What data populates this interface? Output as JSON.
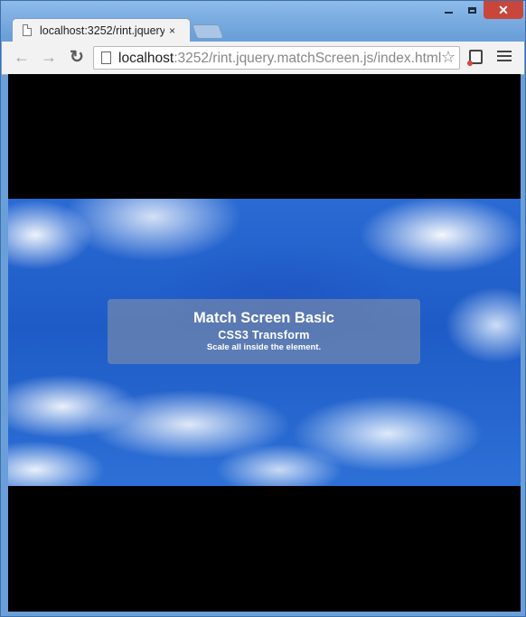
{
  "browser": {
    "tab": {
      "title": "localhost:3252/rint.jquery",
      "close": "×"
    },
    "address_bar": {
      "host": "localhost",
      "rest": ":3252/rint.jquery.matchScreen.js/index.html"
    },
    "icons": {
      "back": "←",
      "forward": "→",
      "reload": "↻",
      "bookmark": "☆",
      "window_close": "✕"
    }
  },
  "page": {
    "caption": {
      "title": "Match Screen Basic",
      "subtitle": "CSS3 Transform",
      "description": "Scale all inside the element."
    }
  }
}
